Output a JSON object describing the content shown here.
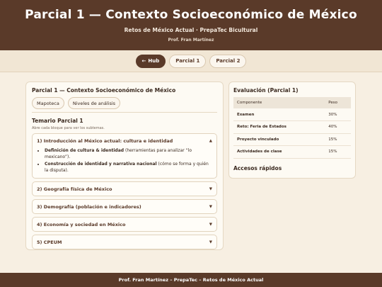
{
  "header": {
    "title": "Parcial 1 — Contexto Socioeconómico de México",
    "subtitle": "Retos de México Actual · PrepaTec Bicultural",
    "professor": "Prof. Fran Martínez"
  },
  "nav": {
    "hub_arrow": "←",
    "hub_label": "Hub",
    "parcial1": "Parcial 1",
    "parcial2": "Parcial 2"
  },
  "main": {
    "card_title": "Parcial 1 — Contexto Socioeconómico de México",
    "pills": [
      "Mapoteca",
      "Niveles de análisis"
    ],
    "temario_title": "Temario Parcial 1",
    "temario_hint": "Abre cada bloque para ver los subtemas.",
    "topics": [
      {
        "label": "1) Introducción al México actual: cultura e identidad",
        "caret": "▲",
        "items": [
          {
            "bold": "Definición de cultura & identidad",
            "rest": " (herramientas para analizar “lo mexicano”)."
          },
          {
            "bold": "Construcción de identidad y narrativa nacional",
            "rest": " (cómo se forma y quién la disputa)."
          }
        ]
      },
      {
        "label": "2) Geografía física de México",
        "caret": "▼"
      },
      {
        "label": "3) Demografía (población e indicadores)",
        "caret": "▼"
      },
      {
        "label": "4) Economía y sociedad en México",
        "caret": "▼"
      },
      {
        "label": "5) CPEUM",
        "caret": "▼"
      }
    ]
  },
  "evaluation": {
    "title": "Evaluación (Parcial 1)",
    "columns": [
      "Componente",
      "Peso"
    ],
    "rows": [
      {
        "component": "Examen",
        "weight": "30%"
      },
      {
        "component": "Reto: Feria de Estados",
        "weight": "40%"
      },
      {
        "component": "Proyecto vinculado",
        "weight": "15%"
      },
      {
        "component": "Actividades de clase",
        "weight": "15%"
      }
    ],
    "quick_title": "Accesos rápidos"
  },
  "footer": {
    "text": "Prof. Fran Martínez – PrepaTec – Retos de México Actual"
  },
  "colors": {
    "brand": "#5a3a29",
    "background": "#f7efe2",
    "card": "#fdfaf3"
  }
}
